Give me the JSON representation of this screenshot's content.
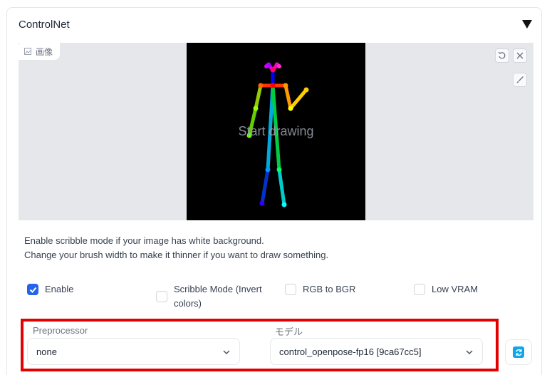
{
  "panel": {
    "title": "ControlNet"
  },
  "image": {
    "tag_label": "画像",
    "canvas_hint": "Start drawing"
  },
  "description": {
    "line1": "Enable scribble mode if your image has white background.",
    "line2": "Change your brush width to make it thinner if you want to draw something."
  },
  "options": {
    "enable": {
      "label": "Enable",
      "checked": true
    },
    "scribble": {
      "label_line1": "Scribble Mode (Invert",
      "label_line2": "colors)",
      "checked": false
    },
    "rgb_to_bgr": {
      "label": "RGB to BGR",
      "checked": false
    },
    "low_vram": {
      "label": "Low VRAM",
      "checked": false
    }
  },
  "preprocessor": {
    "label": "Preprocessor",
    "value": "none"
  },
  "model": {
    "label": "モデル",
    "value": "control_openpose-fp16 [9ca67cc5]"
  },
  "colors": {
    "accent": "#2563eb",
    "highlight": "#e30000",
    "refresh": "#0ea5e9"
  },
  "icons": {
    "collapse": "triangle-down-icon",
    "image_tag": "image-icon",
    "undo": "undo-icon",
    "clear": "close-icon",
    "brush": "brush-icon",
    "chevron": "chevron-down-icon",
    "refresh": "refresh-icon"
  }
}
